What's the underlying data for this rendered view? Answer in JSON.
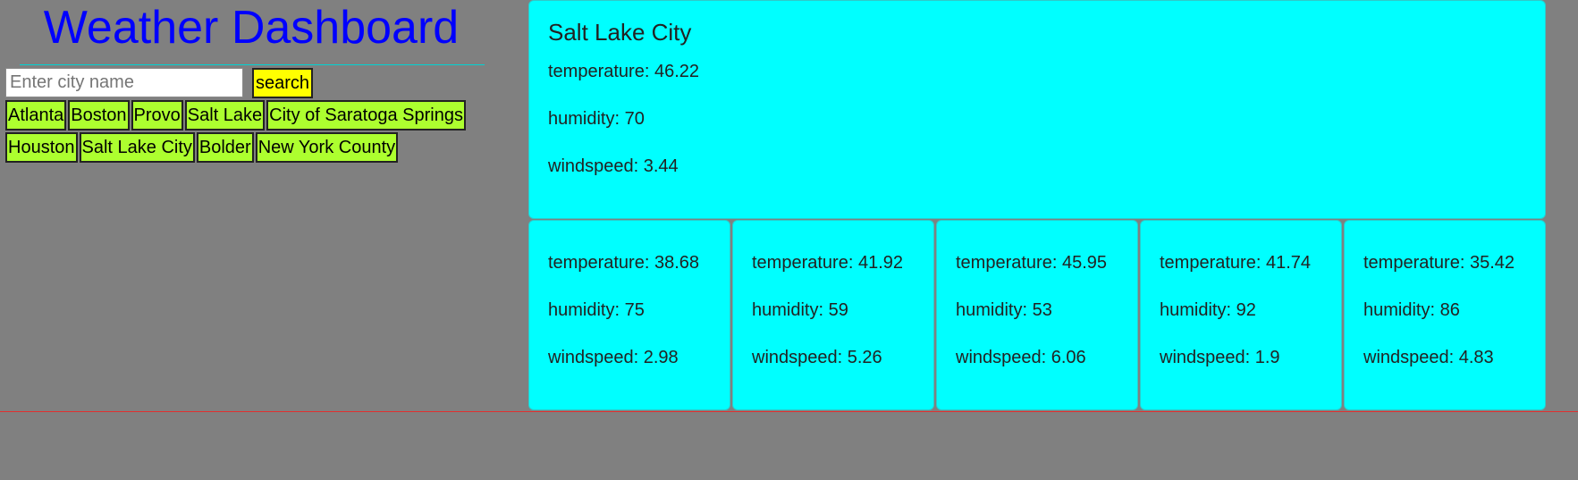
{
  "header": {
    "title": "Weather Dashboard"
  },
  "search": {
    "placeholder": "Enter city name",
    "value": "",
    "button_label": "search"
  },
  "history": {
    "row1": [
      "Atlanta",
      "Boston",
      "Provo",
      "Salt Lake",
      "City of Saratoga Springs"
    ],
    "row2": [
      "Houston",
      "Salt Lake City",
      "Bolder",
      "New York County"
    ]
  },
  "current": {
    "city": "Salt Lake City",
    "temperature": "temperature: 46.22",
    "humidity": "humidity: 70",
    "windspeed": "windspeed: 3.44"
  },
  "forecast": [
    {
      "temperature": "temperature: 38.68",
      "humidity": "humidity: 75",
      "windspeed": "windspeed: 2.98"
    },
    {
      "temperature": "temperature: 41.92",
      "humidity": "humidity: 59",
      "windspeed": "windspeed: 5.26"
    },
    {
      "temperature": "temperature: 45.95",
      "humidity": "humidity: 53",
      "windspeed": "windspeed: 6.06"
    },
    {
      "temperature": "temperature: 41.74",
      "humidity": "humidity: 92",
      "windspeed": "windspeed: 1.9"
    },
    {
      "temperature": "temperature: 35.42",
      "humidity": "humidity: 86",
      "windspeed": "windspeed: 4.83"
    }
  ],
  "colors": {
    "background": "#808080",
    "title": "#0000ff",
    "card": "#00ffff",
    "search_button": "#ffff00",
    "city_button": "#adff2f",
    "divider": "#e03030"
  }
}
